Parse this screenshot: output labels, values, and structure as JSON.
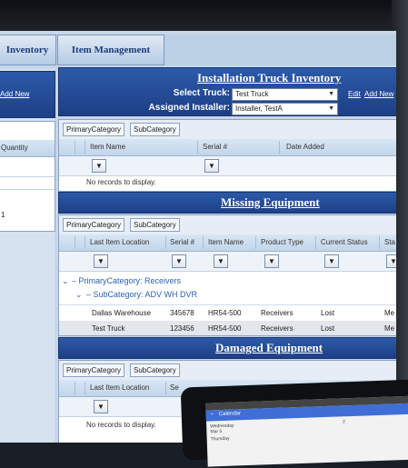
{
  "tabs": [
    "Inventory",
    "Item Management"
  ],
  "left_panel": {
    "add_new": "Add New",
    "column_header": "Quantity",
    "row_value": "1"
  },
  "installation": {
    "title": "Installation Truck Inventory",
    "select_truck_label": "Select Truck:",
    "select_truck_value": "Test Truck",
    "assigned_installer_label": "Assigned Installer:",
    "assigned_installer_value": "Installer, TestA",
    "edit_link": "Edit",
    "add_new_link": "Add New",
    "group_chips": [
      "PrimaryCategory",
      "SubCategory"
    ],
    "columns": [
      "Item Name",
      "Serial #",
      "Date Added"
    ],
    "no_records": "No records to display."
  },
  "missing": {
    "title": "Missing Equipment",
    "group_chips": [
      "PrimaryCategory",
      "SubCategory"
    ],
    "columns": [
      "Last Item Location",
      "Serial #",
      "Item Name",
      "Product Type",
      "Current Status",
      "Sta"
    ],
    "primary_group": "PrimaryCategory: Receivers",
    "sub_group": "SubCategory: ADV WH DVR",
    "rows": [
      [
        "Dallas Warehouse",
        "345678",
        "HR54-500",
        "Receivers",
        "Lost",
        "Me"
      ],
      [
        "Test Truck",
        "123456",
        "HR54-500",
        "Receivers",
        "Lost",
        "Me"
      ]
    ]
  },
  "damaged": {
    "title": "Damaged Equipment",
    "group_chips": [
      "PrimaryCategory",
      "SubCategory"
    ],
    "columns": [
      "Last Item Location",
      "Se"
    ],
    "no_records": "No records to display."
  },
  "tablet": {
    "header": "Calendar",
    "line1": "Wednesday",
    "line2": "Mar 5",
    "line3": "Thursday",
    "number": "2"
  }
}
